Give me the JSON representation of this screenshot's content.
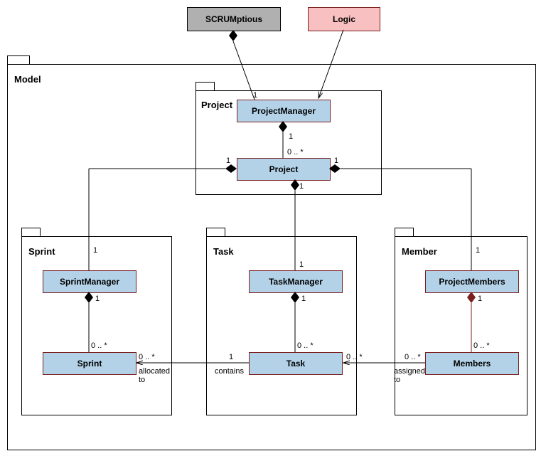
{
  "external": {
    "scrumptious": "SCRUMptious",
    "logic": "Logic"
  },
  "packages": {
    "model": "Model",
    "project": "Project",
    "sprint": "Sprint",
    "task": "Task",
    "member": "Member"
  },
  "classes": {
    "projectManager": "ProjectManager",
    "project": "Project",
    "sprintManager": "SprintManager",
    "sprint": "Sprint",
    "taskManager": "TaskManager",
    "task": "Task",
    "projectMembers": "ProjectMembers",
    "members": "Members"
  },
  "multiplicities": {
    "one": "1",
    "zeroMany": "0 .. *"
  },
  "assocLabels": {
    "contains": "contains",
    "allocatedTo": "allocated\nto",
    "assignedTo": "assigned\nto"
  }
}
